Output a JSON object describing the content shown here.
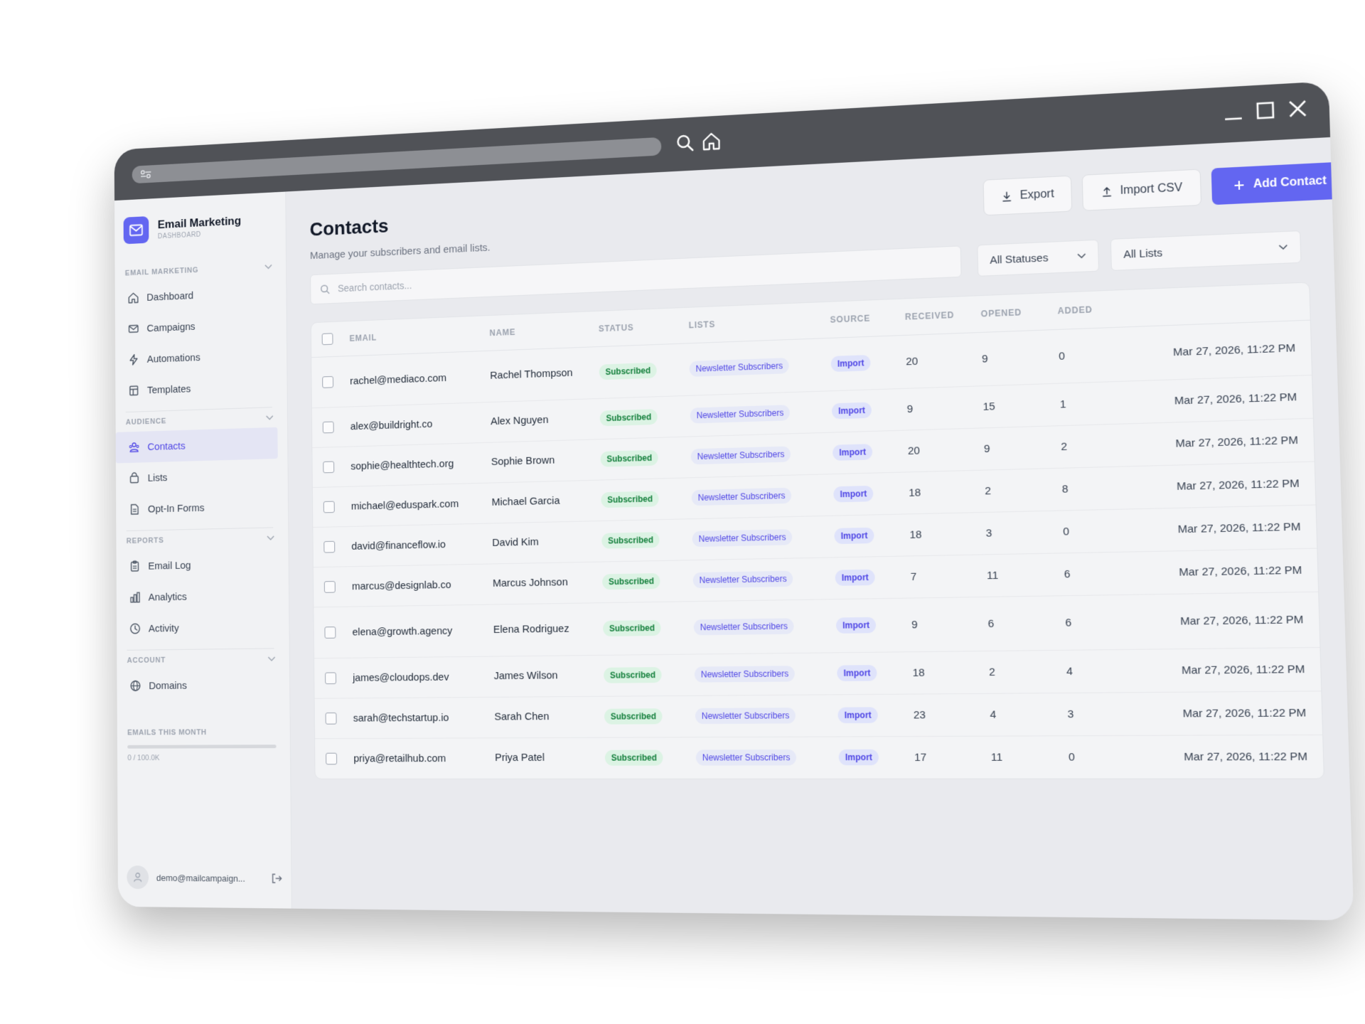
{
  "app": {
    "name": "Email Marketing",
    "subtitle": "DASHBOARD"
  },
  "sidebar": {
    "sections": [
      {
        "title": "EMAIL MARKETING",
        "items": [
          {
            "label": "Dashboard",
            "icon": "home-icon"
          },
          {
            "label": "Campaigns",
            "icon": "mail-icon"
          },
          {
            "label": "Automations",
            "icon": "bolt-icon"
          },
          {
            "label": "Templates",
            "icon": "template-icon"
          }
        ]
      },
      {
        "title": "AUDIENCE",
        "items": [
          {
            "label": "Contacts",
            "icon": "users-icon",
            "active": true
          },
          {
            "label": "Lists",
            "icon": "list-icon"
          },
          {
            "label": "Opt-In Forms",
            "icon": "form-icon"
          }
        ]
      },
      {
        "title": "REPORTS",
        "items": [
          {
            "label": "Email Log",
            "icon": "clipboard-icon"
          },
          {
            "label": "Analytics",
            "icon": "bar-chart-icon"
          },
          {
            "label": "Activity",
            "icon": "clock-icon"
          }
        ]
      },
      {
        "title": "ACCOUNT",
        "items": [
          {
            "label": "Domains",
            "icon": "globe-icon"
          }
        ]
      }
    ],
    "usage": {
      "label": "EMAILS THIS MONTH",
      "value": "0 / 100.0K",
      "fraction": 0.0
    },
    "user_email": "demo@mailcampaign..."
  },
  "page": {
    "title": "Contacts",
    "subtitle": "Manage your subscribers and email lists.",
    "export_label": "Export",
    "import_label": "Import CSV",
    "add_label": "Add Contact",
    "search_placeholder": "Search contacts...",
    "status_filter": "All Statuses",
    "list_filter": "All Lists"
  },
  "table": {
    "columns": [
      "EMAIL",
      "NAME",
      "STATUS",
      "LISTS",
      "SOURCE",
      "RECEIVED",
      "OPENED",
      "ADDED"
    ],
    "rows": [
      {
        "email": "rachel@mediaco.com",
        "name": "Rachel Thompson",
        "status": "Subscribed",
        "list": "Newsletter Subscribers",
        "source": "Import",
        "received": "20",
        "opened": "9",
        "added": "0",
        "date": "Mar 27, 2026, 11:22 PM"
      },
      {
        "email": "alex@buildright.co",
        "name": "Alex Nguyen",
        "status": "Subscribed",
        "list": "Newsletter Subscribers",
        "source": "Import",
        "received": "9",
        "opened": "15",
        "added": "1",
        "date": "Mar 27, 2026, 11:22 PM"
      },
      {
        "email": "sophie@healthtech.org",
        "name": "Sophie Brown",
        "status": "Subscribed",
        "list": "Newsletter Subscribers",
        "source": "Import",
        "received": "20",
        "opened": "9",
        "added": "2",
        "date": "Mar 27, 2026, 11:22 PM"
      },
      {
        "email": "michael@eduspark.com",
        "name": "Michael Garcia",
        "status": "Subscribed",
        "list": "Newsletter Subscribers",
        "source": "Import",
        "received": "18",
        "opened": "2",
        "added": "8",
        "date": "Mar 27, 2026, 11:22 PM"
      },
      {
        "email": "david@financeflow.io",
        "name": "David Kim",
        "status": "Subscribed",
        "list": "Newsletter Subscribers",
        "source": "Import",
        "received": "18",
        "opened": "3",
        "added": "0",
        "date": "Mar 27, 2026, 11:22 PM"
      },
      {
        "email": "marcus@designlab.co",
        "name": "Marcus Johnson",
        "status": "Subscribed",
        "list": "Newsletter Subscribers",
        "source": "Import",
        "received": "7",
        "opened": "11",
        "added": "6",
        "date": "Mar 27, 2026, 11:22 PM"
      },
      {
        "email": "elena@growth.agency",
        "name": "Elena Rodriguez",
        "status": "Subscribed",
        "list": "Newsletter Subscribers",
        "source": "Import",
        "received": "9",
        "opened": "6",
        "added": "6",
        "date": "Mar 27, 2026, 11:22 PM"
      },
      {
        "email": "james@cloudops.dev",
        "name": "James Wilson",
        "status": "Subscribed",
        "list": "Newsletter Subscribers",
        "source": "Import",
        "received": "18",
        "opened": "2",
        "added": "4",
        "date": "Mar 27, 2026, 11:22 PM"
      },
      {
        "email": "sarah@techstartup.io",
        "name": "Sarah Chen",
        "status": "Subscribed",
        "list": "Newsletter Subscribers",
        "source": "Import",
        "received": "23",
        "opened": "4",
        "added": "3",
        "date": "Mar 27, 2026, 11:22 PM"
      },
      {
        "email": "priya@retailhub.com",
        "name": "Priya Patel",
        "status": "Subscribed",
        "list": "Newsletter Subscribers",
        "source": "Import",
        "received": "17",
        "opened": "11",
        "added": "0",
        "date": "Mar 27, 2026, 11:22 PM"
      }
    ]
  },
  "colors": {
    "accent": "#6366f1",
    "subscribed_bg": "#dcf3e4",
    "subscribed_text": "#15803d",
    "titlebar": "#505257"
  }
}
